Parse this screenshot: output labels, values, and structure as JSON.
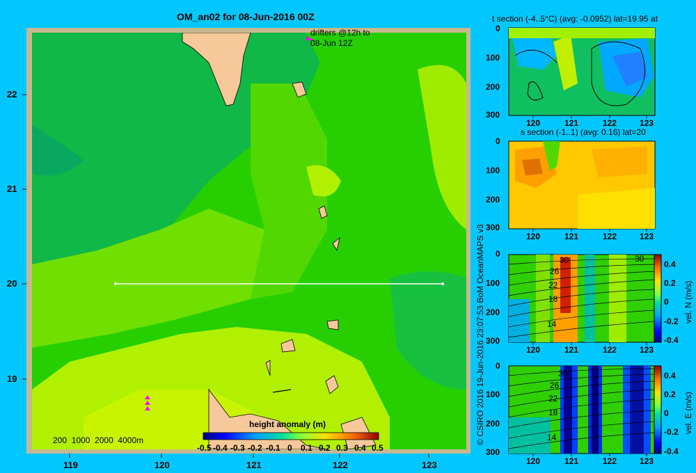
{
  "main_map": {
    "title": "OM_an02 for 08-Jun-2016 00Z",
    "drifter_note_1": "drifters @12h to",
    "drifter_note_2": "08-Jun 12Z",
    "depth_legend": "200  1000  2000  4000m",
    "x_ticks": [
      "119",
      "120",
      "121",
      "122",
      "123"
    ],
    "y_ticks": [
      "22",
      "21",
      "20",
      "19"
    ],
    "section_lat": 20,
    "section_lon": [
      119.5,
      123.2
    ],
    "colorbar": {
      "title": "height anomaly  (m)",
      "ticks": [
        "-0.5",
        "-0.4",
        "-0.3",
        "-0.2",
        "-0.1",
        "0",
        "0.1",
        "0.2",
        "0.3",
        "0.4",
        "0.5"
      ]
    },
    "colors": {
      "background": "#00c8ff",
      "land": "#f6c89a",
      "frame": "#c8b890",
      "section_line": "#ffffff",
      "drifters": "#ff00ff"
    }
  },
  "credit": "© CSIRO 2016   19-Jun-2016 23:07:53 BoM OceanMAPS v3",
  "panels": [
    {
      "title": "t section (-4..5°C)  (avg: -0.0952)  lat=19.95 at",
      "y_ticks": [
        "0",
        "100",
        "200",
        "300"
      ],
      "x_ticks": [
        "120",
        "121",
        "122",
        "123"
      ]
    },
    {
      "title": "s section (-1..1)  (avg: 0.16)  lat=20",
      "y_ticks": [
        "0",
        "100",
        "200",
        "300"
      ],
      "x_ticks": [
        "120",
        "121",
        "122",
        "123"
      ]
    },
    {
      "title": "",
      "y_ticks": [
        "0",
        "100",
        "200",
        "300"
      ],
      "x_ticks": [
        "120",
        "121",
        "122",
        "123"
      ],
      "contour_labels": [
        "30",
        "26",
        "22",
        "18",
        "14",
        "30"
      ],
      "colorbar_label": "vel. N (m/s)",
      "colorbar_ticks": [
        "0.4",
        "0.2",
        "0",
        "-0.2",
        "-0.4"
      ]
    },
    {
      "title": "",
      "y_ticks": [
        "0",
        "100",
        "200",
        "300"
      ],
      "x_ticks": [
        "120",
        "121",
        "122",
        "123"
      ],
      "contour_labels": [
        "30",
        "26",
        "22",
        "18",
        "14"
      ],
      "colorbar_label": "vel. E (m/s)",
      "colorbar_ticks": [
        "0.4",
        "0.2",
        "0",
        "-0.2",
        "-0.4"
      ]
    }
  ]
}
